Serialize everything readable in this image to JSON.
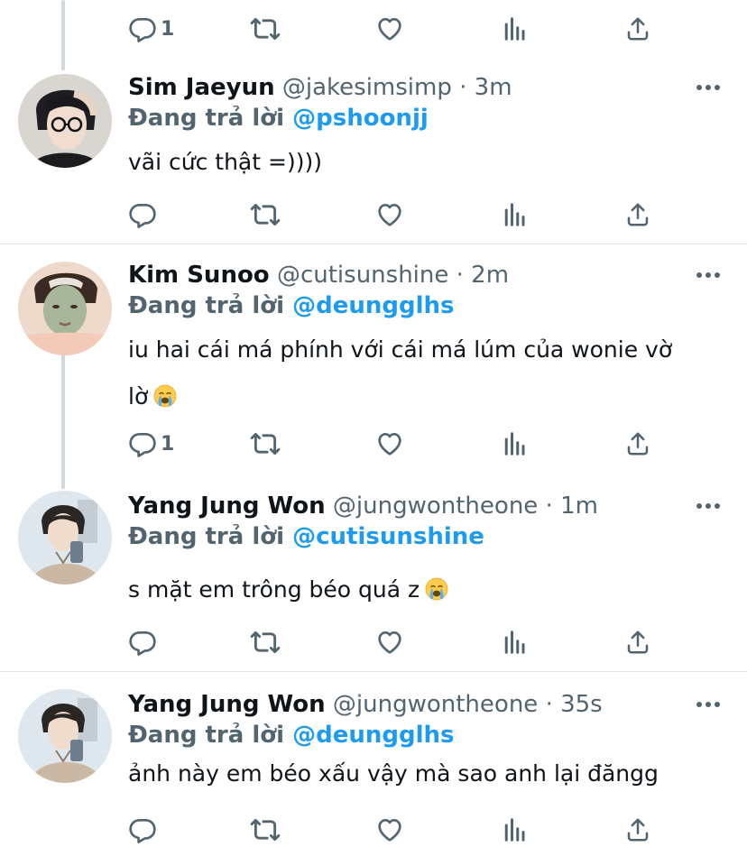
{
  "top_actions": {
    "reply_count": "1"
  },
  "tweets": [
    {
      "name": "Sim Jaeyun",
      "handle": "@jakesimsimp",
      "time": "3m",
      "separator": "·",
      "reply_prefix": "Đang trả lời",
      "reply_to": "@pshoonjj",
      "text": "vãi cức thật =))))",
      "reply_count": ""
    },
    {
      "name": "Kim Sunoo",
      "handle": "@cutisunshine",
      "time": "2m",
      "separator": "·",
      "reply_prefix": "Đang trả lời",
      "reply_to": "@deungglhs",
      "text_line1": "iu hai cái má phính với cái má lúm của wonie vờ",
      "text_line2": "lờ",
      "emoji": "loudly-crying-face",
      "reply_count": "1"
    },
    {
      "name": "Yang Jung Won",
      "handle": "@jungwontheone",
      "time": "1m",
      "separator": "·",
      "reply_prefix": "Đang trả lời",
      "reply_to": "@cutisunshine",
      "text": "s mặt em trông béo quá z",
      "emoji": "loudly-crying-face",
      "reply_count": ""
    },
    {
      "name": "Yang Jung Won",
      "handle": "@jungwontheone",
      "time": "35s",
      "separator": "·",
      "reply_prefix": "Đang trả lời",
      "reply_to": "@deungglhs",
      "text": "ảnh này em béo xấu vậy mà sao anh lại đăngg",
      "reply_count": ""
    }
  ],
  "colors": {
    "accent": "#1d9bf0",
    "secondary": "#536471",
    "divider": "#e1e6ea",
    "thread": "#cfd9de"
  }
}
